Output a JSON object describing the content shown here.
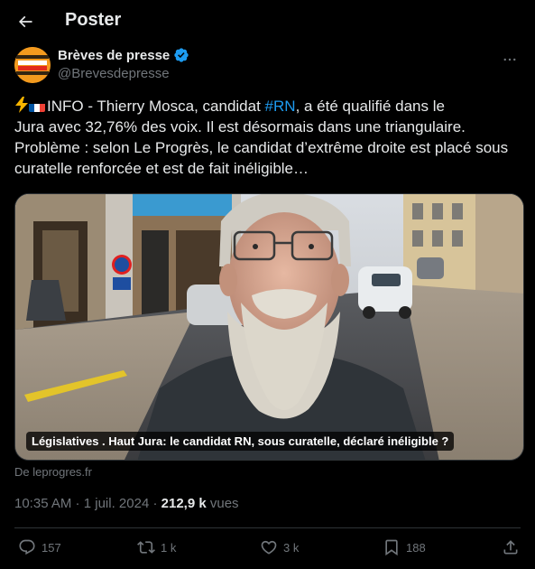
{
  "header": {
    "title": "Poster"
  },
  "author": {
    "avatar_text_top": "BRÈVES",
    "avatar_text_bottom": "DE PRESSE",
    "display_name": "Brèves de presse",
    "handle": "@Brevesdepresse",
    "verified": true
  },
  "tweet": {
    "line1_pre": "INFO - Thierry Mosca, candidat ",
    "hashtag": "#RN",
    "line1_post": ", a été qualifié dans le",
    "line2": "Jura avec 32,76% des voix. Il est désormais dans une triangulaire.",
    "line3": "Problème : selon Le Progrès, le candidat d’extrême droite est placé sous",
    "line4": "curatelle renforcée et est de fait inéligible…"
  },
  "card": {
    "caption": "Législatives . Haut Jura: le candidat RN, sous curatelle, déclaré inéligible ?",
    "source": "De leprogres.fr"
  },
  "meta": {
    "time": "10:35 AM",
    "separator": " · ",
    "date": "1 juil. 2024",
    "views_count": "212,9 k",
    "views_label": " vues"
  },
  "actions": {
    "replies": "157",
    "reposts": "1 k",
    "likes": "3 k",
    "bookmarks": "188"
  },
  "colors": {
    "background": "#000000",
    "text": "#e7e9ea",
    "secondary": "#71767b",
    "accent": "#1d9bf0",
    "divider": "#2f3336"
  }
}
